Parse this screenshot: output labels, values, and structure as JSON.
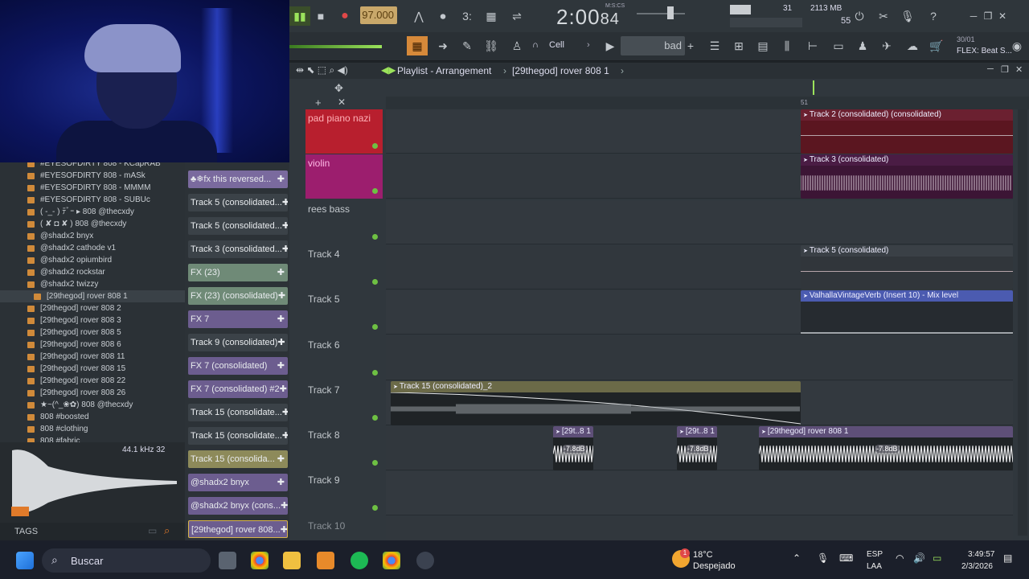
{
  "transport": {
    "tempo": "97.000",
    "time": "2:00",
    "time_frac": "84",
    "time_label": "M:S:CS",
    "cpu_num": "31",
    "mem": "2113 MB",
    "mem2": "55",
    "snap": "Cell",
    "pattern_sel": "bad",
    "hint_line1": "30/01",
    "hint_line2": "FLEX: Beat S..."
  },
  "playlist": {
    "title": "Playlist - Arrangement",
    "breadcrumb": "[29thegod] rover 808 1",
    "ruler_mark": "51",
    "tracks": [
      {
        "label": "pad piano nazi",
        "color": "#b81f2e",
        "text_color": "#ffb0b6"
      },
      {
        "label": "violin",
        "color": "#9c1e6e",
        "text_color": "#ffb8e6"
      },
      {
        "label": "rees bass",
        "color": "",
        "text_color": "#c3c8cd"
      },
      {
        "label": "Track 4",
        "color": "",
        "text_color": "#c3c8cd"
      },
      {
        "label": "Track 5",
        "color": "",
        "text_color": "#c3c8cd"
      },
      {
        "label": "Track 6",
        "color": "",
        "text_color": "#c3c8cd"
      },
      {
        "label": "Track 7",
        "color": "",
        "text_color": "#c3c8cd"
      },
      {
        "label": "Track 8",
        "color": "",
        "text_color": "#c3c8cd"
      },
      {
        "label": "Track 9",
        "color": "",
        "text_color": "#c3c8cd"
      },
      {
        "label": "Track 10",
        "color": "",
        "text_color": "#8a9096"
      }
    ],
    "clips": [
      {
        "name": "Track 2 (consolidated) (consolidated)"
      },
      {
        "name": "Track 3 (consolidated)"
      },
      {
        "name": "Track 5 (consolidated)"
      },
      {
        "name": "ValhallaVintageVerb (Insert 10) - Mix level"
      },
      {
        "name": "Track 15 (consolidated)_2"
      },
      {
        "name": "[29t..8 1"
      },
      {
        "name": "[29t..8 1"
      },
      {
        "name": "[29thegod] rover 808 1"
      }
    ],
    "gain_labels": [
      "-7.8dB",
      "-7.8dB",
      "-7.8dB"
    ]
  },
  "browser": {
    "items": [
      "#EYESOFDIRTY 808 - KCapRAB",
      "#EYESOFDIRTY 808 - mASk",
      "#EYESOFDIRTY 808 - MMMM",
      "#EYESOFDIRTY 808 - SUBUc",
      "( -_- ) ﾃﾞｰ ▸ 808 @thecxdy",
      "( ✘ ◘ ✘ ) 808 @thecxdy",
      "@shadx2 bnyx",
      "@shadx2 cathode v1",
      "@shadx2 opiumbird",
      "@shadx2 rockstar",
      "@shadx2 twizzy",
      "[29thegod] rover 808 1",
      "[29thegod] rover 808 2",
      "[29thegod] rover 808 3",
      "[29thegod] rover 808 5",
      "[29thegod] rover 808 6",
      "[29thegod] rover 808 11",
      "[29thegod] rover 808 15",
      "[29thegod] rover 808 22",
      "[29thegod] rover 808 26",
      "★~(^_❀✿) 808 @thecxdy",
      "808 #boosted",
      "808 #clothing",
      "808 #fabric"
    ],
    "sample_info": "44.1 kHz 32",
    "tags_label": "TAGS"
  },
  "picker": {
    "items": [
      {
        "label": "♣❄fx this reversed...",
        "color": "#7a6a9e"
      },
      {
        "label": "Track 5 (consolidated...",
        "color": "#3b4248"
      },
      {
        "label": "Track 5 (consolidated...",
        "color": "#3b4248"
      },
      {
        "label": "Track 3 (consolidated...",
        "color": "#3b4248"
      },
      {
        "label": "FX (23)",
        "color": "#6f8a77"
      },
      {
        "label": "FX (23) (consolidated)",
        "color": "#6f8a77"
      },
      {
        "label": "FX 7",
        "color": "#6c5d8f"
      },
      {
        "label": "Track 9 (consolidated)",
        "color": "#3b4248"
      },
      {
        "label": "FX 7 (consolidated)",
        "color": "#6c5d8f"
      },
      {
        "label": "FX 7 (consolidated) #2",
        "color": "#6c5d8f"
      },
      {
        "label": "Track 15 (consolidate...",
        "color": "#3b4248"
      },
      {
        "label": "Track 15 (consolidate...",
        "color": "#3b4248"
      },
      {
        "label": "Track 15 (consolida...",
        "color": "#8d8a5a"
      },
      {
        "label": "@shadx2 bnyx",
        "color": "#6c5d8f"
      },
      {
        "label": "@shadx2 bnyx (cons...",
        "color": "#6c5d8f"
      },
      {
        "label": "[29thegod] rover 808...",
        "color": "#6c5d8f"
      }
    ]
  },
  "taskbar": {
    "search": "Buscar",
    "weather_temp": "18°C",
    "weather_desc": "Despejado",
    "lang1": "ESP",
    "lang2": "LAA",
    "clock_time": "3:49:57",
    "clock_date": "2/3/2026",
    "notif": "1"
  }
}
